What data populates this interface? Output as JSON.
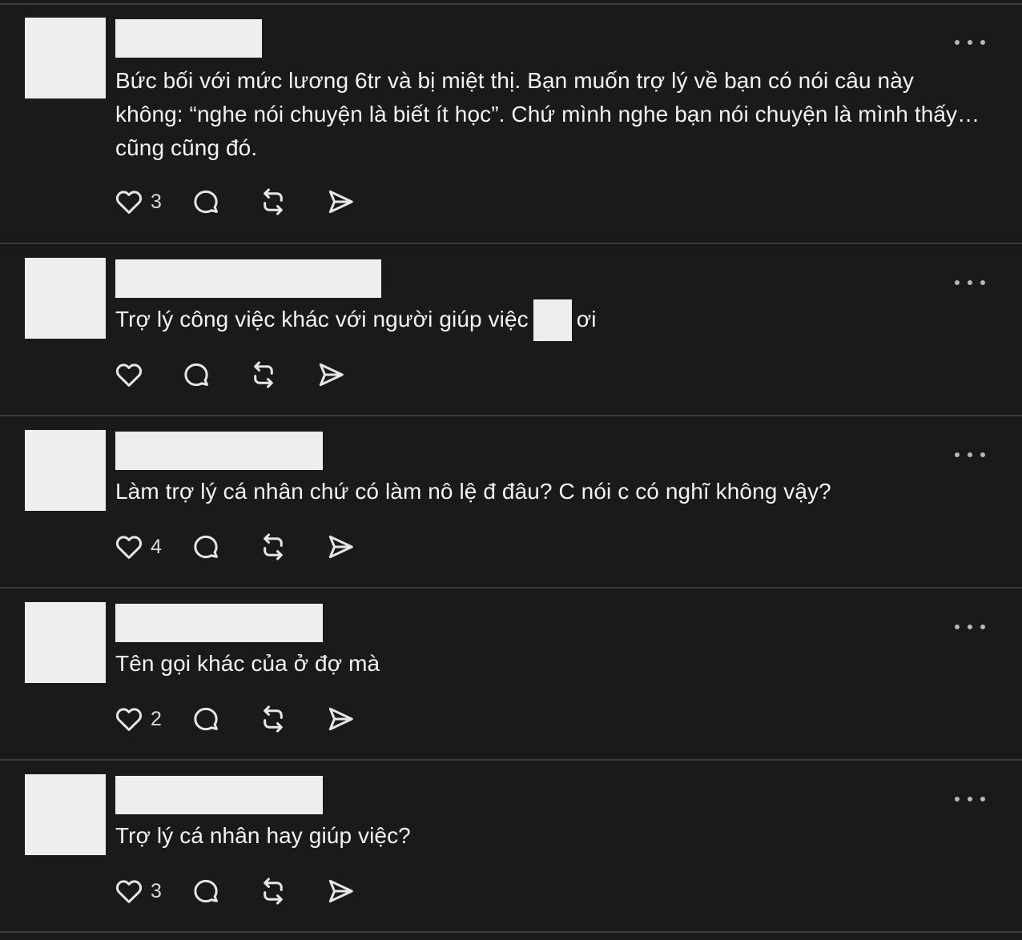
{
  "posts": [
    {
      "text": "Bức bối với mức lương 6tr và bị miệt thị. Bạn muốn trợ lý về bạn có nói câu này không: “nghe nói chuyện là biết ít học”. Chứ mình nghe bạn nói chuyện là mình thấy… cũng cũng đó.",
      "like_count": "3"
    },
    {
      "text_before": "Trợ lý công việc khác với người giúp việc",
      "text_after": "ơi",
      "like_count": ""
    },
    {
      "text": "Làm trợ lý cá nhân chứ có làm nô lệ đ đâu? C nói c có nghĩ không vậy?",
      "like_count": "4"
    },
    {
      "text": "Tên gọi khác của ở đợ mà",
      "like_count": "2"
    },
    {
      "text": "Trợ lý cá nhân hay giúp việc?",
      "like_count": "3"
    }
  ],
  "icons": {
    "like": "heart-icon",
    "reply": "comment-bubble-icon",
    "repost": "repost-icon",
    "share": "send-icon",
    "more": "more-horizontal-icon"
  },
  "colors": {
    "background": "#1a1a1a",
    "text": "#f3f3f3",
    "divider": "#3a3a3a",
    "icon": "#e6e6e6",
    "redaction": "#eeeeee"
  }
}
